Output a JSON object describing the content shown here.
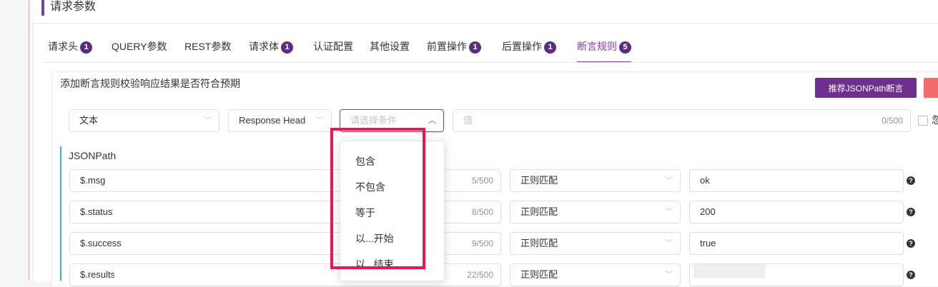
{
  "section_title": "请求参数",
  "tabs": [
    {
      "label": "请求头",
      "badge": "1"
    },
    {
      "label": "QUERY参数",
      "badge": ""
    },
    {
      "label": "REST参数",
      "badge": ""
    },
    {
      "label": "请求体",
      "badge": "1"
    },
    {
      "label": "认证配置",
      "badge": ""
    },
    {
      "label": "其他设置",
      "badge": ""
    },
    {
      "label": "前置操作",
      "badge": "1"
    },
    {
      "label": "后置操作",
      "badge": "1"
    },
    {
      "label": "断言规则",
      "badge": "5"
    }
  ],
  "assert": {
    "description": "添加断言规则校验响应结果是否符合预期",
    "recommend_button": "推荐JSONPath断言",
    "new_rule": {
      "type": "文本",
      "source": "Response Head",
      "condition_placeholder": "请选择条件",
      "value_placeholder": "值",
      "value_counter": "0/500",
      "checkbox_label": "忽"
    },
    "jsonpath_label": "JSONPath",
    "rules": [
      {
        "path": "$.msg",
        "counter": "5/500",
        "match": "正则匹配",
        "expected": "ok"
      },
      {
        "path": "$.status",
        "counter": "8/500",
        "match": "正则匹配",
        "expected": "200"
      },
      {
        "path": "$.success",
        "counter": "9/500",
        "match": "正则匹配",
        "expected": "true"
      },
      {
        "path": "$.results",
        "counter": "22/500",
        "match": "正则匹配",
        "expected": ""
      }
    ]
  },
  "dropdown_options": [
    "包含",
    "不包含",
    "等于",
    "以...开始",
    "以...结束"
  ]
}
